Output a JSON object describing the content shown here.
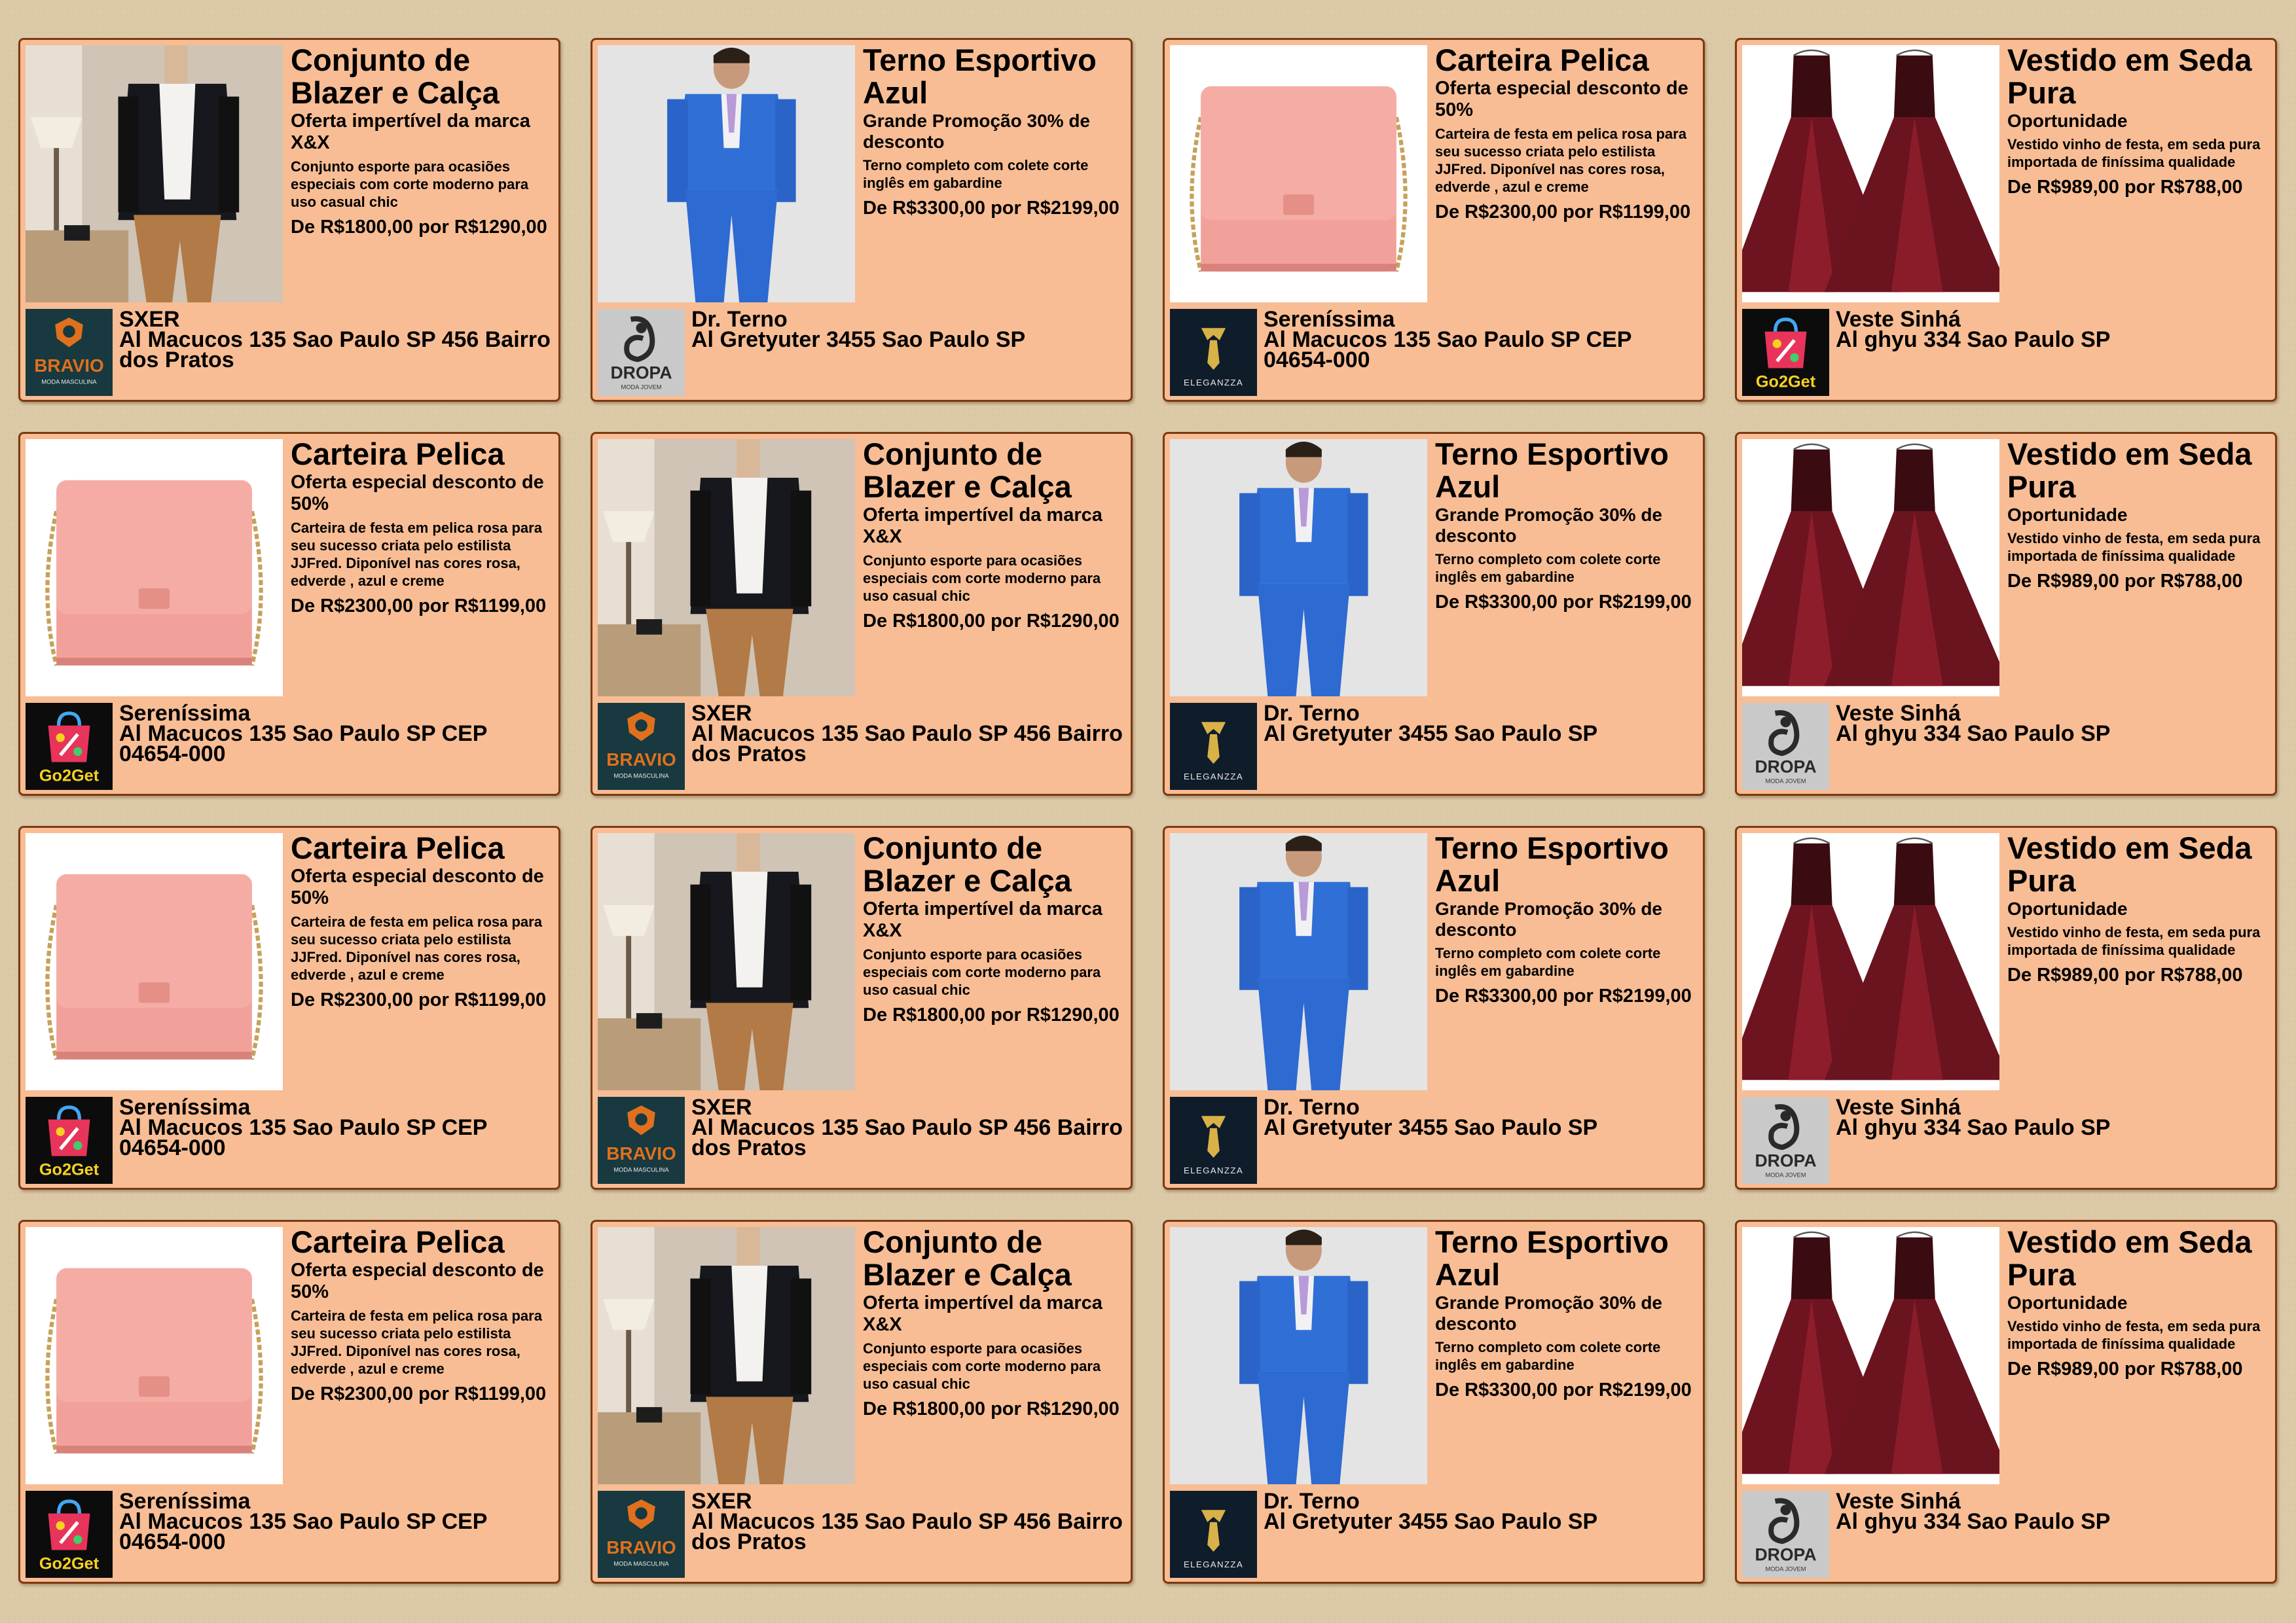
{
  "cards": [
    {
      "product": "blazer",
      "title": "Conjunto de Blazer e Calça",
      "subtitle": "Oferta impertível da marca X&X",
      "description": "Conjunto esporte para ocasiões especiais com corte moderno para uso casual chic",
      "price": "De R$1800,00 por R$1290,00",
      "brand": "bravio",
      "store_name": "SXER",
      "address": "Al Macucos 135 Sao Paulo SP 456 Bairro dos Pratos"
    },
    {
      "product": "suit",
      "title": "Terno Esportivo Azul",
      "subtitle": "Grande Promoção 30% de desconto",
      "description": "Terno completo com colete corte inglês em gabardine",
      "price": "De R$3300,00 por R$2199,00",
      "brand": "dropa",
      "store_name": "Dr. Terno",
      "address": "Al Gretyuter 3455 Sao Paulo SP"
    },
    {
      "product": "bag",
      "title": "Carteira Pelica",
      "subtitle": "Oferta especial desconto de 50%",
      "description": "Carteira de festa em pelica rosa para seu sucesso criata pelo estilista JJFred. Diponível nas cores rosa, edverde , azul e creme",
      "price": "De R$2300,00 por R$1199,00",
      "brand": "eleganzza",
      "store_name": "Sereníssima",
      "address": "Al Macucos 135 Sao Paulo SP CEP 04654-000"
    },
    {
      "product": "dress",
      "title": "Vestido em Seda Pura",
      "subtitle": "Oportunidade",
      "description": "Vestido vinho de festa, em seda pura importada de finíssima qualidade",
      "price": "De R$989,00 por R$788,00",
      "brand": "go2get",
      "store_name": "Veste Sinhá",
      "address": "Al ghyu 334 Sao Paulo SP"
    },
    {
      "product": "bag",
      "title": "Carteira Pelica",
      "subtitle": "Oferta especial desconto de 50%",
      "description": "Carteira de festa em pelica rosa para seu sucesso criata pelo estilista JJFred. Diponível nas cores rosa, edverde , azul e creme",
      "price": "De R$2300,00 por R$1199,00",
      "brand": "go2get",
      "store_name": "Sereníssima",
      "address": "Al Macucos 135 Sao Paulo SP CEP 04654-000"
    },
    {
      "product": "blazer",
      "title": "Conjunto de Blazer e Calça",
      "subtitle": "Oferta impertível da marca X&X",
      "description": "Conjunto esporte para ocasiões especiais com corte moderno para uso casual chic",
      "price": "De R$1800,00 por R$1290,00",
      "brand": "bravio",
      "store_name": "SXER",
      "address": "Al Macucos 135 Sao Paulo SP 456 Bairro dos Pratos"
    },
    {
      "product": "suit",
      "title": "Terno Esportivo Azul",
      "subtitle": "Grande Promoção 30% de desconto",
      "description": "Terno completo com colete corte inglês em gabardine",
      "price": "De R$3300,00 por R$2199,00",
      "brand": "eleganzza",
      "store_name": "Dr. Terno",
      "address": "Al Gretyuter 3455 Sao Paulo SP"
    },
    {
      "product": "dress",
      "title": "Vestido em Seda Pura",
      "subtitle": "Oportunidade",
      "description": "Vestido vinho de festa, em seda pura importada de finíssima qualidade",
      "price": "De R$989,00 por R$788,00",
      "brand": "dropa",
      "store_name": "Veste Sinhá",
      "address": "Al ghyu 334 Sao Paulo SP"
    },
    {
      "product": "bag",
      "title": "Carteira Pelica",
      "subtitle": "Oferta especial desconto de 50%",
      "description": "Carteira de festa em pelica rosa para seu sucesso criata pelo estilista JJFred. Diponível nas cores rosa, edverde , azul e creme",
      "price": "De R$2300,00 por R$1199,00",
      "brand": "go2get",
      "store_name": "Sereníssima",
      "address": "Al Macucos 135 Sao Paulo SP CEP 04654-000"
    },
    {
      "product": "blazer",
      "title": "Conjunto de Blazer e Calça",
      "subtitle": "Oferta impertível da marca X&X",
      "description": "Conjunto esporte para ocasiões especiais com corte moderno para uso casual chic",
      "price": "De R$1800,00 por R$1290,00",
      "brand": "bravio",
      "store_name": "SXER",
      "address": "Al Macucos 135 Sao Paulo SP 456 Bairro dos Pratos"
    },
    {
      "product": "suit",
      "title": "Terno Esportivo Azul",
      "subtitle": "Grande Promoção 30% de desconto",
      "description": "Terno completo com colete corte inglês em gabardine",
      "price": "De R$3300,00 por R$2199,00",
      "brand": "eleganzza",
      "store_name": "Dr. Terno",
      "address": "Al Gretyuter 3455 Sao Paulo SP"
    },
    {
      "product": "dress",
      "title": "Vestido em Seda Pura",
      "subtitle": "Oportunidade",
      "description": "Vestido vinho de festa, em seda pura importada de finíssima qualidade",
      "price": "De R$989,00 por R$788,00",
      "brand": "dropa",
      "store_name": "Veste Sinhá",
      "address": "Al ghyu 334 Sao Paulo SP"
    },
    {
      "product": "bag",
      "title": "Carteira Pelica",
      "subtitle": "Oferta especial desconto de 50%",
      "description": "Carteira de festa em pelica rosa para seu sucesso criata pelo estilista JJFred. Diponível nas cores rosa, edverde , azul e creme",
      "price": "De R$2300,00 por R$1199,00",
      "brand": "go2get",
      "store_name": "Sereníssima",
      "address": "Al Macucos 135 Sao Paulo SP CEP 04654-000"
    },
    {
      "product": "blazer",
      "title": "Conjunto de Blazer e Calça",
      "subtitle": "Oferta impertível da marca X&X",
      "description": "Conjunto esporte para ocasiões especiais com corte moderno para uso casual chic",
      "price": "De R$1800,00 por R$1290,00",
      "brand": "bravio",
      "store_name": "SXER",
      "address": "Al Macucos 135 Sao Paulo SP 456 Bairro dos Pratos"
    },
    {
      "product": "suit",
      "title": "Terno Esportivo Azul",
      "subtitle": "Grande Promoção 30% de desconto",
      "description": "Terno completo com colete corte inglês em gabardine",
      "price": "De R$3300,00 por R$2199,00",
      "brand": "eleganzza",
      "store_name": "Dr. Terno",
      "address": "Al Gretyuter 3455 Sao Paulo SP"
    },
    {
      "product": "dress",
      "title": "Vestido em Seda Pura",
      "subtitle": "Oportunidade",
      "description": "Vestido vinho de festa, em seda pura importada de finíssima qualidade",
      "price": "De R$989,00 por R$788,00",
      "brand": "dropa",
      "store_name": "Veste Sinhá",
      "address": "Al ghyu 334 Sao Paulo SP"
    }
  ],
  "logos": {
    "bravio": {
      "word": "BRAVIO",
      "tag": "MODA MASCULINA",
      "bg": "#17393f",
      "accent": "#e0701e"
    },
    "dropa": {
      "word": "DROPA",
      "tag": "MODA JOVEM",
      "bg": "#c9c9c9",
      "accent": "#2a2a2a"
    },
    "eleganzza": {
      "word": "ELEGANZZA",
      "tag": "",
      "bg": "#0f1c2a",
      "accent": "#d8b248"
    },
    "go2get": {
      "word": "Go2Get",
      "tag": "",
      "bg": "#0c0c0c",
      "accent": "#e8345a"
    }
  }
}
